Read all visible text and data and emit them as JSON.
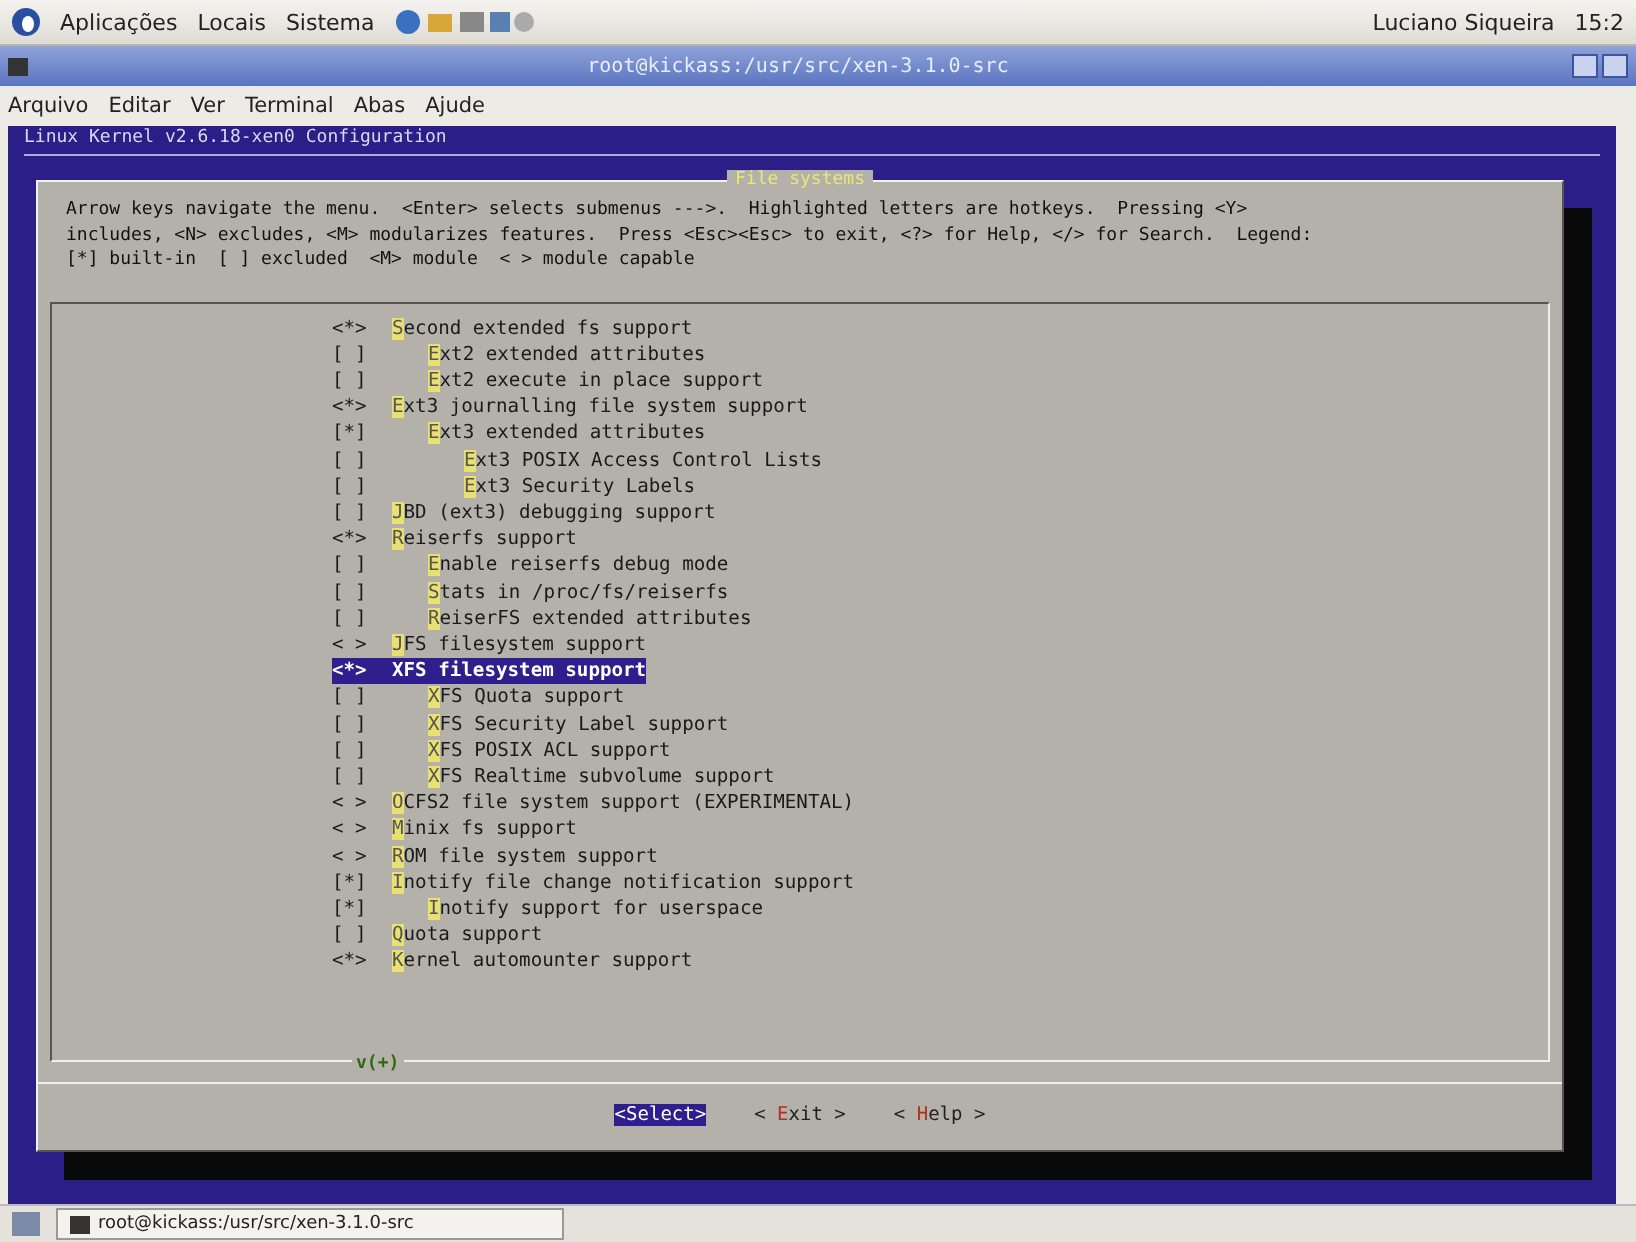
{
  "top_panel": {
    "menus": [
      "Aplicações",
      "Locais",
      "Sistema"
    ],
    "user": "Luciano Siqueira",
    "clock": "15:2"
  },
  "window": {
    "title": "root@kickass:/usr/src/xen-3.1.0-src",
    "menus": [
      "Arquivo",
      "Editar",
      "Ver",
      "Terminal",
      "Abas",
      "Ajude"
    ]
  },
  "terminal": {
    "heading": "Linux Kernel v2.6.18-xen0 Configuration",
    "dialog": {
      "title": "File systems",
      "help": [
        "Arrow keys navigate the menu.  <Enter> selects submenus --->.  Highlighted letters are hotkeys.  Pressing <Y>",
        "includes, <N> excludes, <M> modularizes features.  Press <Esc><Esc> to exit, <?> for Help, </> for Search.  Legend:",
        "[*] built-in  [ ] excluded  <M> module  < > module capable"
      ],
      "items": [
        {
          "prefix": "<*>",
          "label": "Second extended fs support",
          "selected": false,
          "children": [
            {
              "prefix": "[ ]",
              "label": "Ext2 extended attributes",
              "selected": false
            },
            {
              "prefix": "[ ]",
              "label": "Ext2 execute in place support",
              "selected": false
            }
          ]
        },
        {
          "prefix": "<*>",
          "label": "Ext3 journalling file system support",
          "selected": false,
          "children": [
            {
              "prefix": "[*]",
              "label": "Ext3 extended attributes",
              "selected": false,
              "children": [
                {
                  "prefix": "[ ]",
                  "label": "Ext3 POSIX Access Control Lists",
                  "selected": false
                },
                {
                  "prefix": "[ ]",
                  "label": "Ext3 Security Labels",
                  "selected": false
                }
              ]
            }
          ]
        },
        {
          "prefix": "[ ]",
          "label": "JBD (ext3) debugging support",
          "selected": false
        },
        {
          "prefix": "<*>",
          "label": "Reiserfs support",
          "selected": false,
          "children": [
            {
              "prefix": "[ ]",
              "label": "Enable reiserfs debug mode",
              "selected": false
            },
            {
              "prefix": "[ ]",
              "label": "Stats in /proc/fs/reiserfs",
              "selected": false
            },
            {
              "prefix": "[ ]",
              "label": "ReiserFS extended attributes",
              "selected": false
            }
          ]
        },
        {
          "prefix": "< >",
          "label": "JFS filesystem support",
          "selected": false
        },
        {
          "prefix": "<*>",
          "label": "XFS filesystem support",
          "selected": true,
          "children": [
            {
              "prefix": "[ ]",
              "label": "XFS Quota support",
              "selected": false
            },
            {
              "prefix": "[ ]",
              "label": "XFS Security Label support",
              "selected": false
            },
            {
              "prefix": "[ ]",
              "label": "XFS POSIX ACL support",
              "selected": false
            },
            {
              "prefix": "[ ]",
              "label": "XFS Realtime subvolume support",
              "selected": false
            }
          ]
        },
        {
          "prefix": "< >",
          "label": "OCFS2 file system support (EXPERIMENTAL)",
          "selected": false
        },
        {
          "prefix": "< >",
          "label": "Minix fs support",
          "selected": false
        },
        {
          "prefix": "< >",
          "label": "ROM file system support",
          "selected": false
        },
        {
          "prefix": "[*]",
          "label": "Inotify file change notification support",
          "selected": false,
          "children": [
            {
              "prefix": "[*]",
              "label": "Inotify support for userspace",
              "selected": false
            }
          ]
        },
        {
          "prefix": "[ ]",
          "label": "Quota support",
          "selected": false
        },
        {
          "prefix": "<*>",
          "label": "Kernel automounter support",
          "selected": false
        }
      ],
      "more": "v(+)",
      "buttons": [
        {
          "label": "<Select>",
          "selected": true
        },
        {
          "label": "< Exit >",
          "selected": false
        },
        {
          "label": "< Help >",
          "selected": false
        }
      ]
    }
  },
  "taskbar": {
    "items": [
      "root@kickass:/usr/src/xen-3.1.0-src"
    ]
  }
}
